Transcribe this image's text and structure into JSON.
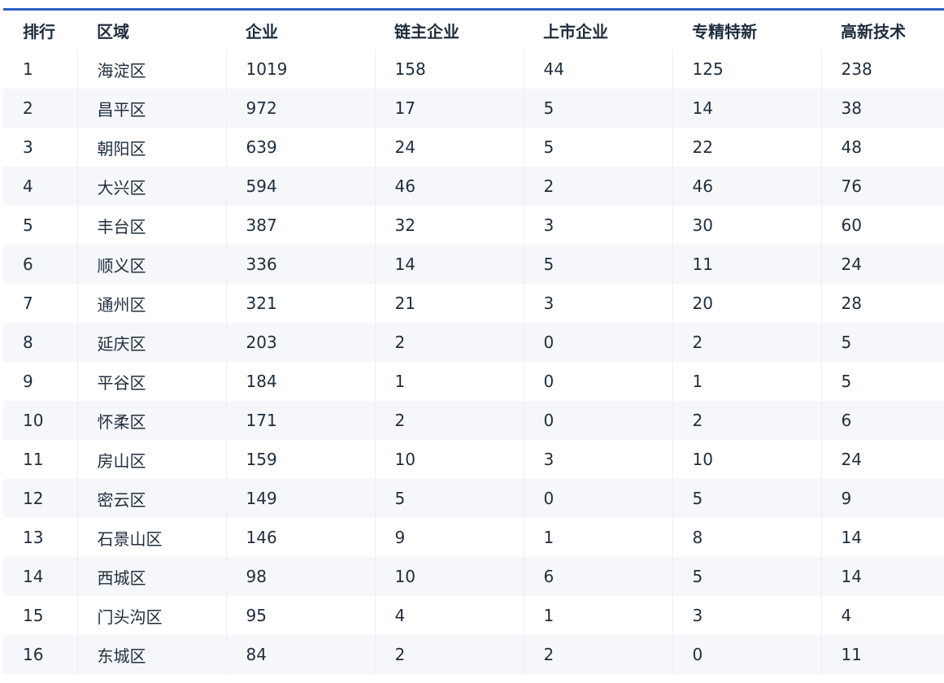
{
  "table": {
    "headers": [
      "排行",
      "区域",
      "企业",
      "链主企业",
      "上市企业",
      "专精特新",
      "高新技术"
    ],
    "rows": [
      [
        "1",
        "海淀区",
        "1019",
        "158",
        "44",
        "125",
        "238"
      ],
      [
        "2",
        "昌平区",
        "972",
        "17",
        "5",
        "14",
        "38"
      ],
      [
        "3",
        "朝阳区",
        "639",
        "24",
        "5",
        "22",
        "48"
      ],
      [
        "4",
        "大兴区",
        "594",
        "46",
        "2",
        "46",
        "76"
      ],
      [
        "5",
        "丰台区",
        "387",
        "32",
        "3",
        "30",
        "60"
      ],
      [
        "6",
        "顺义区",
        "336",
        "14",
        "5",
        "11",
        "24"
      ],
      [
        "7",
        "通州区",
        "321",
        "21",
        "3",
        "20",
        "28"
      ],
      [
        "8",
        "延庆区",
        "203",
        "2",
        "0",
        "2",
        "5"
      ],
      [
        "9",
        "平谷区",
        "184",
        "1",
        "0",
        "1",
        "5"
      ],
      [
        "10",
        "怀柔区",
        "171",
        "2",
        "0",
        "2",
        "6"
      ],
      [
        "11",
        "房山区",
        "159",
        "10",
        "3",
        "10",
        "24"
      ],
      [
        "12",
        "密云区",
        "149",
        "5",
        "0",
        "5",
        "9"
      ],
      [
        "13",
        "石景山区",
        "146",
        "9",
        "1",
        "8",
        "14"
      ],
      [
        "14",
        "西城区",
        "98",
        "10",
        "6",
        "5",
        "14"
      ],
      [
        "15",
        "门头沟区",
        "95",
        "4",
        "1",
        "3",
        "4"
      ],
      [
        "16",
        "东城区",
        "84",
        "2",
        "2",
        "0",
        "11"
      ]
    ]
  },
  "colors": {
    "accent_bar": "#2d5fc4",
    "stripe": "#f5f7fa",
    "text": "#1f2d3d"
  }
}
